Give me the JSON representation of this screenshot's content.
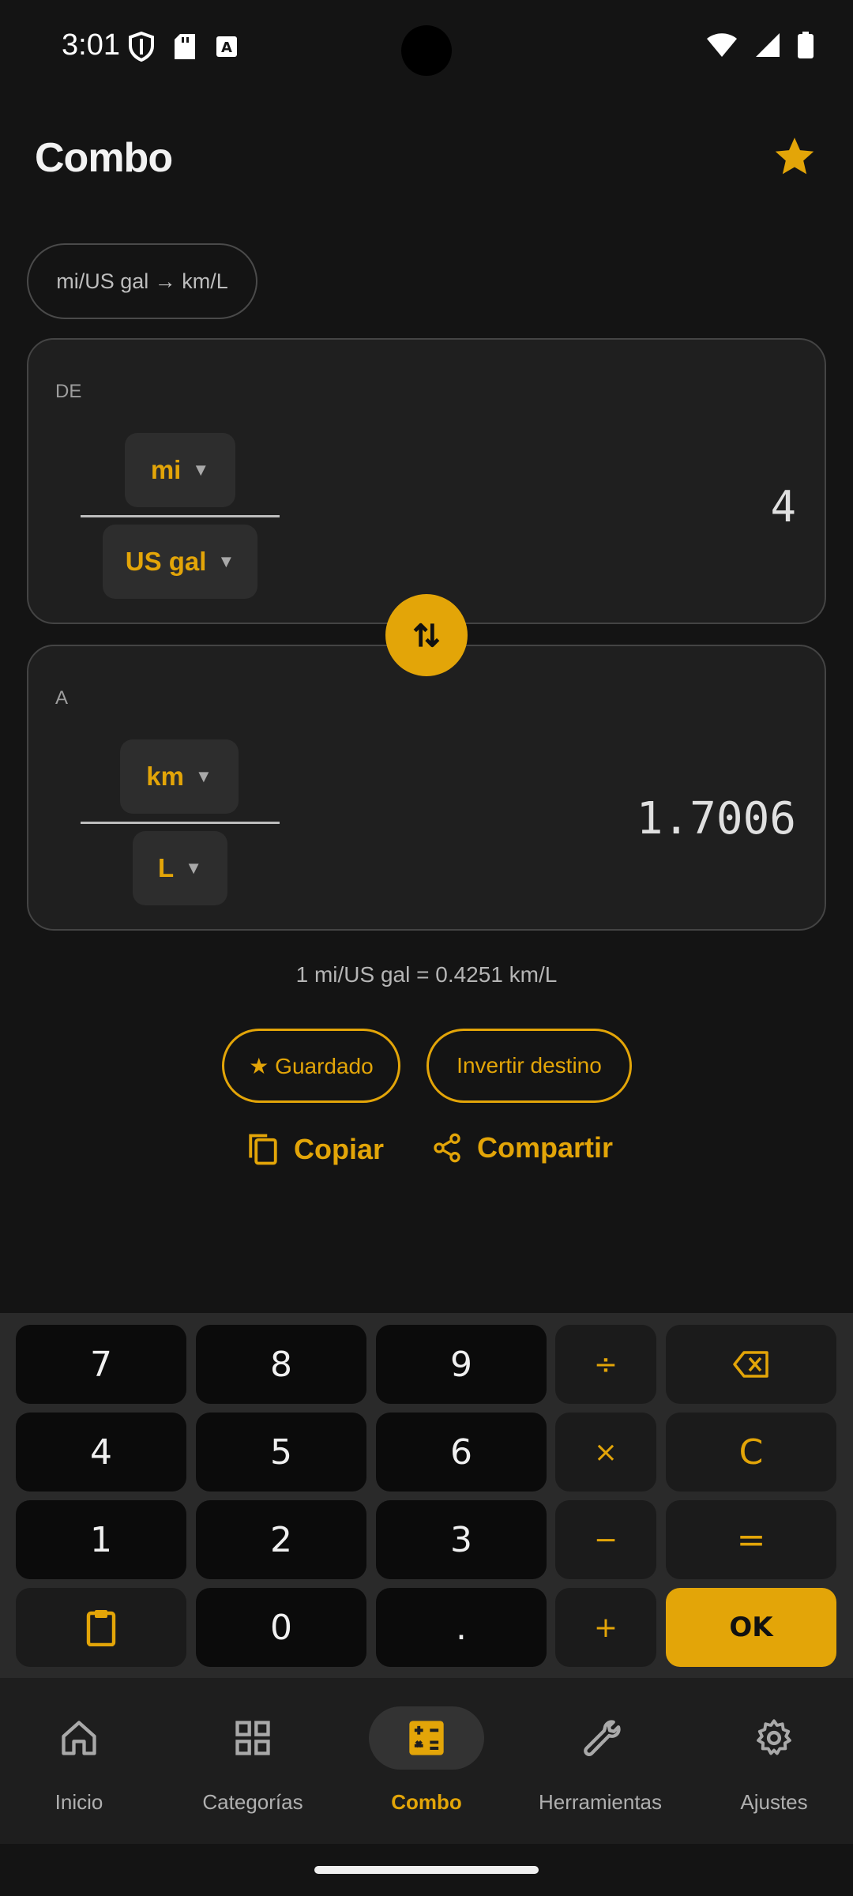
{
  "status": {
    "time": "3:01",
    "icons_left": [
      "shield-icon",
      "sd-card-icon",
      "keyboard-notif-icon"
    ],
    "icons_right": [
      "wifi-icon",
      "signal-icon",
      "battery-icon"
    ]
  },
  "header": {
    "title": "Combo",
    "favorite_icon": "star-icon"
  },
  "chip": {
    "label": "mi/US gal → km/L"
  },
  "from": {
    "label": "DE",
    "numerator": "mi",
    "denominator": "US gal",
    "value": "4"
  },
  "to": {
    "label": "A",
    "numerator": "km",
    "denominator": "L",
    "value": "1.7006"
  },
  "ratio": "1 mi/US gal = 0.4251 km/L",
  "pills": {
    "saved": "★ Guardado",
    "invert": "Invertir destino"
  },
  "actions": {
    "copy": "Copiar",
    "share": "Compartir"
  },
  "keypad": {
    "rows": [
      [
        "7",
        "8",
        "9",
        "÷",
        "⌫"
      ],
      [
        "4",
        "5",
        "6",
        "×",
        "C"
      ],
      [
        "1",
        "2",
        "3",
        "−",
        "="
      ],
      [
        "paste",
        "0",
        ".",
        "+",
        "OK"
      ]
    ]
  },
  "nav": {
    "items": [
      {
        "label": "Inicio",
        "icon": "home-icon"
      },
      {
        "label": "Categorías",
        "icon": "grid-icon"
      },
      {
        "label": "Combo",
        "icon": "calculator-icon"
      },
      {
        "label": "Herramientas",
        "icon": "wrench-icon"
      },
      {
        "label": "Ajustes",
        "icon": "gear-icon"
      }
    ],
    "active": "Combo"
  },
  "colors": {
    "accent": "#e3a508",
    "background": "#141414",
    "panel": "#1f1f1f"
  }
}
